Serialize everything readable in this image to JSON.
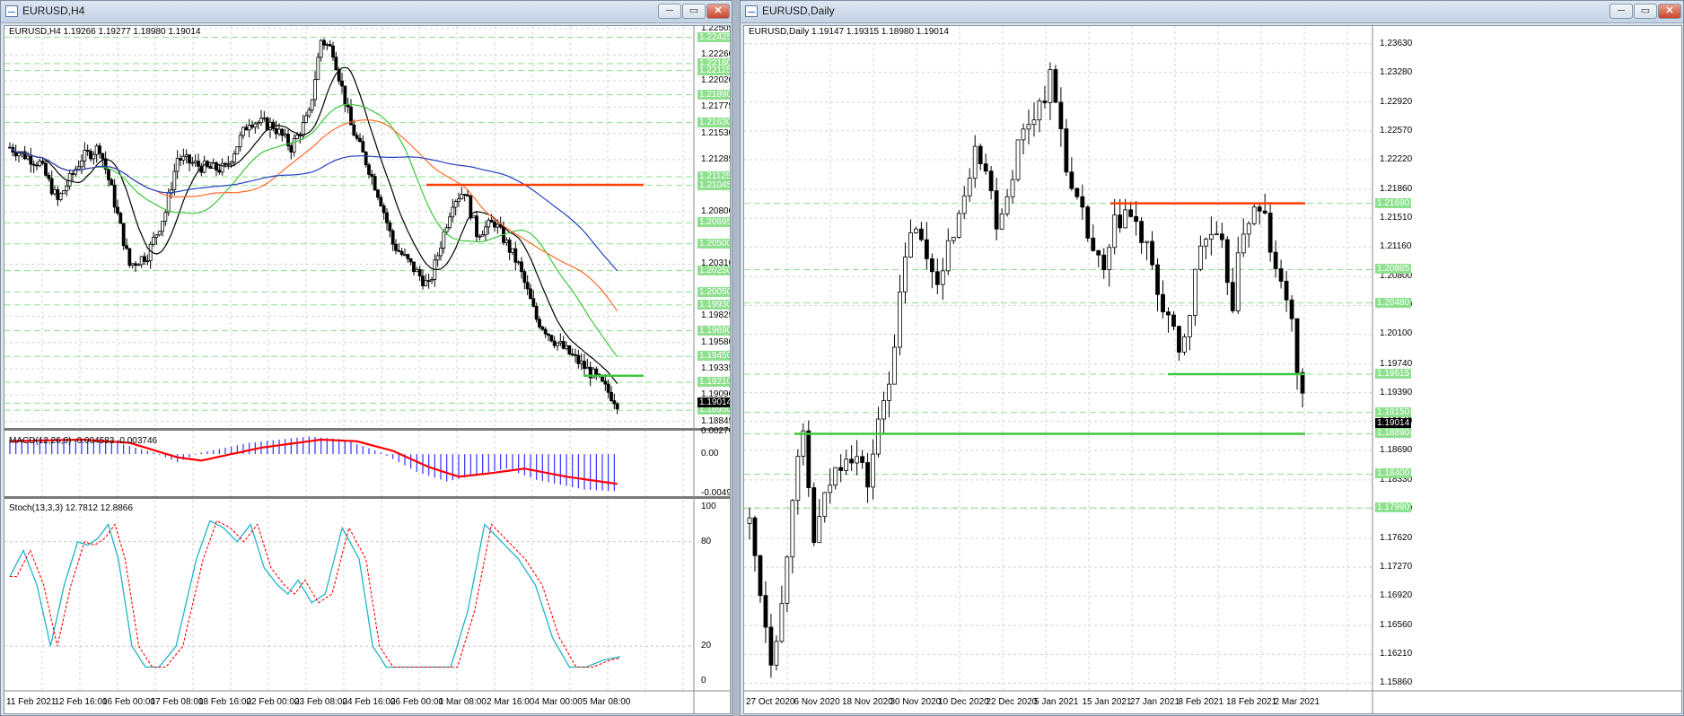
{
  "colors": {
    "bull_candle": "#ffffff",
    "bear_candle": "#000000",
    "level_line": "#8ee08e",
    "support_line": "#3cc83c",
    "resistance_line": "#ff4000",
    "macd_hist": "#3030ff",
    "macd_signal": "#ff0000",
    "stoch_main": "#20b4c8",
    "stoch_signal": "#ff0000",
    "ma_black": "#000000",
    "ma_green": "#3cc83c",
    "ma_orange": "#ff6a2a",
    "ma_blue": "#2040c0"
  },
  "left": {
    "title": "EURUSD,H4",
    "buttons": {
      "minimize": "─",
      "restore": "▭",
      "close": "✕"
    },
    "info": "EURUSD,H4  1.19266 1.19277 1.18980 1.19014",
    "macd_label": "MACD(12,26,9) -0.004583 -0.003746",
    "stoch_label": "Stoch(13,3,3) 12.7812 12.8866",
    "price_scale": [
      "1.22505",
      "1.22260",
      "1.22020",
      "1.21775",
      "1.21530",
      "1.21285",
      "1.20800",
      "1.20310",
      "1.19825",
      "1.19580",
      "1.19335",
      "1.19090",
      "1.18845"
    ],
    "green_levels": [
      "1.22425",
      "1.22180",
      "1.22115",
      "1.21890",
      "1.21630",
      "1.21125",
      "1.21045",
      "1.20695",
      "1.20500",
      "1.20250",
      "1.20050",
      "1.19930",
      "1.19690",
      "1.19450",
      "1.19210",
      "1.19014",
      "1.18950"
    ],
    "current_price": "1.19014",
    "macd_scale": [
      "0.002762",
      "0.00",
      "-0.004933"
    ],
    "stoch_scale": [
      "100",
      "80",
      "20",
      "0"
    ],
    "dates": [
      "11 Feb 2021",
      "12 Feb 16:00",
      "16 Feb 00:00",
      "17 Feb 08:00",
      "18 Feb 16:00",
      "22 Feb 00:00",
      "23 Feb 08:00",
      "24 Feb 16:00",
      "26 Feb 00:00",
      "1 Mar 08:00",
      "2 Mar 16:00",
      "4 Mar 00:00",
      "5 Mar 08:00"
    ]
  },
  "right": {
    "title": "EURUSD,Daily",
    "buttons": {
      "minimize": "─",
      "restore": "▭",
      "close": "✕"
    },
    "info": "EURUSD,Daily  1.19147 1.19315 1.18980 1.19014",
    "price_scale": [
      "1.23630",
      "1.23280",
      "1.22920",
      "1.22570",
      "1.22220",
      "1.21860",
      "1.21510",
      "1.21160",
      "1.20800",
      "1.20450",
      "1.20100",
      "1.19740",
      "1.19390",
      "1.19040",
      "1.18690",
      "1.18330",
      "1.17980",
      "1.17620",
      "1.17270",
      "1.16920",
      "1.16560",
      "1.16210",
      "1.15860"
    ],
    "green_levels": [
      "1.21690",
      "1.20885",
      "1.20480",
      "1.19615",
      "1.19150",
      "1.18890",
      "1.18400",
      "1.17990"
    ],
    "current_price": "1.19014",
    "dates": [
      "27 Oct 2020",
      "6 Nov 2020",
      "18 Nov 2020",
      "30 Nov 2020",
      "10 Dec 2020",
      "22 Dec 2020",
      "5 Jan 2021",
      "15 Jan 2021",
      "27 Jan 2021",
      "8 Feb 2021",
      "18 Feb 2021",
      "2 Mar 2021"
    ]
  }
}
